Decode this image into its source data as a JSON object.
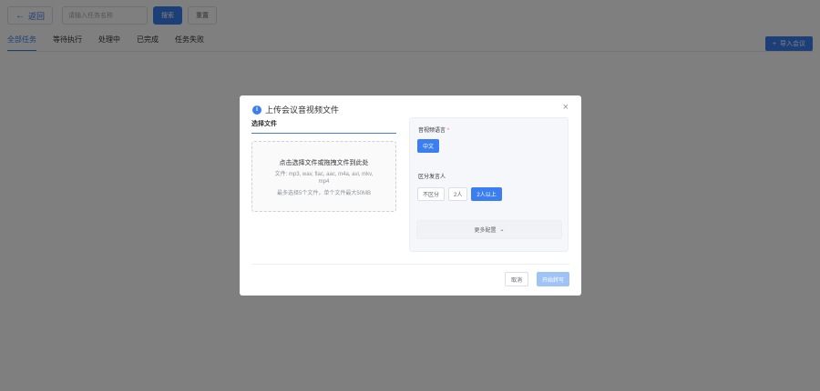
{
  "topbar": {
    "back_label": "返回",
    "search_placeholder": "请输入任务名称",
    "search_label": "搜索",
    "reset_label": "重置"
  },
  "tabs": [
    {
      "label": "全部任务",
      "active": true
    },
    {
      "label": "等待执行",
      "active": false
    },
    {
      "label": "处理中",
      "active": false
    },
    {
      "label": "已完成",
      "active": false
    },
    {
      "label": "任务失败",
      "active": false
    }
  ],
  "import_label": "导入会议",
  "dialog": {
    "title": "上传会议音视频文件",
    "select_file_title": "选择文件",
    "dropzone_main": "点击选择文件或拖拽文件到此处",
    "dropzone_types": "文件: mp3, wav, flac, aac, m4a, avi, mkv, mp4",
    "dropzone_limit": "最多选择5个文件，单个文件最大50MB",
    "language_label": "音视频语言",
    "language_required": "*",
    "language_option": "中文",
    "speaker_label": "区分发言人",
    "speaker_options": [
      "不区分",
      "2人",
      "2人以上"
    ],
    "speaker_selected": "2人以上",
    "more_settings": "更多配置",
    "cancel_label": "取消",
    "start_label": "开始转写"
  },
  "colors": {
    "accent": "#3a7ef0",
    "disabled_accent": "#a0c3f7",
    "overlay": "rgba(0,0,0,0.5)"
  }
}
